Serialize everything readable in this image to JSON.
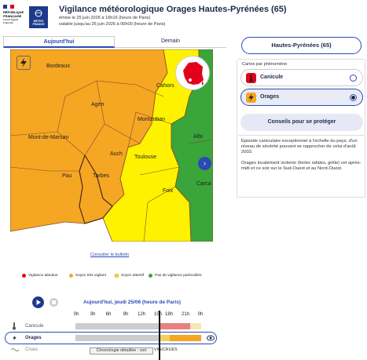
{
  "header": {
    "republic_lines": [
      "RÉPUBLIQUE",
      "FRANÇAISE"
    ],
    "republic_motto": "Liberté Égalité Fraternité",
    "mf_logo_text": [
      "METEO",
      "FRANCE"
    ],
    "title": "Vigilance météorologique Orages Hautes-Pyrénées (65)",
    "issued": "émise le 25 juin 2026 à 16h16 (heure de Paris)",
    "valid": "valable jusqu'au 26 juin 2026 à 00h00 (heure de Paris)"
  },
  "tabs": [
    {
      "label": "Aujourd'hui",
      "active": true
    },
    {
      "label": "Demain",
      "active": false
    }
  ],
  "map": {
    "cities": [
      "Bordeaux",
      "Agen",
      "Cahors",
      "Montauban",
      "Albi",
      "Mont-de-Marsan",
      "Auch",
      "Toulouse",
      "Pau",
      "Tarbes",
      "Foix",
      "Carca"
    ],
    "colors": {
      "orange": "#f5a623",
      "yellow": "#fff200",
      "green": "#3aa53a",
      "red": "#e3001b",
      "border": "#8a4b2a"
    },
    "subscribe_link": "Consulter le bulletin",
    "next_icon": "chevron-right-icon"
  },
  "legend": [
    {
      "label": "Vigilance absolue",
      "color": "#e3001b"
    },
    {
      "label": "Soyez très vigilant",
      "color": "#f5a623"
    },
    {
      "label": "Soyez attentif",
      "color": "#fff200"
    },
    {
      "label": "Pas de vigilance particulière",
      "color": "#3aa53a"
    }
  ],
  "panel": {
    "department_button": "Hautes-Pyrénées (65)",
    "cards_title": "Cartes par phénomène",
    "phenomena": [
      {
        "label": "Canicule",
        "icon": "thermometer-icon",
        "color": "#e3001b",
        "selected": false
      },
      {
        "label": "Orages",
        "icon": "lightning-icon",
        "color": "#f5a623",
        "selected": true
      }
    ],
    "advice_button": "Conseils pour se protéger",
    "descriptions": [
      "Épisode caniculaire exceptionnel à l'échelle du pays, d'un niveau de sévérité pouvant se rapprocher de celui d'août 2003.",
      "Orages localement violents (fortes rafales, grêle) cet après-midi et ce soir sur le Sud-Ouest et au Nord-Ouest."
    ]
  },
  "timeline": {
    "title": "Aujourd'hui, jeudi 25/06 (heure de Paris)",
    "hours": [
      "0h",
      "3h",
      "6h",
      "9h",
      "12h",
      "15h",
      "18h",
      "21h",
      "0h"
    ],
    "rows": [
      {
        "label": "Canicule",
        "icon": "thermometer-icon"
      },
      {
        "label": "Orages",
        "icon": "lightning-icon"
      },
      {
        "label": "Crues",
        "icon": "wave-icon"
      }
    ],
    "chrono_button": "Chronologie détaillée : voir",
    "vigicrues": "VIGICRUES",
    "eye_icon": "eye-icon"
  }
}
